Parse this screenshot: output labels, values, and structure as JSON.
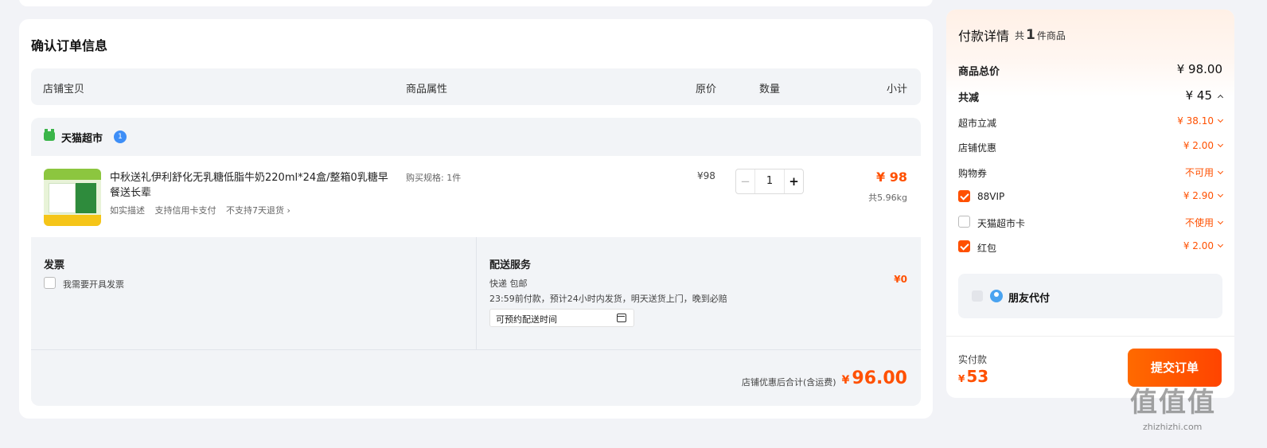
{
  "order": {
    "title": "确认订单信息",
    "headers": {
      "item": "店铺宝贝",
      "attr": "商品属性",
      "price": "原价",
      "qty": "数量",
      "subtotal": "小计"
    },
    "store": {
      "name": "天猫超市",
      "badge": "1"
    },
    "item": {
      "title": "中秋送礼伊利舒化无乳糖低脂牛奶220ml*24盒/整箱0乳糖早餐送长辈",
      "tags": [
        "如实描述",
        "支持信用卡支付",
        "不支持7天退货 ›"
      ],
      "spec": "购买规格: 1件",
      "price": "¥98",
      "qty": "1",
      "subtotal": "¥ 98",
      "weight": "共5.96kg"
    },
    "invoice": {
      "title": "发票",
      "option": "我需要开具发票"
    },
    "delivery": {
      "title": "配送服务",
      "method": "快递 包邮",
      "desc": "23:59前付款，预计24小时内发货，明天送货上门，晚到必赔",
      "input_placeholder": "可预约配送时间",
      "price": "¥0"
    },
    "total": {
      "label": "店铺优惠后合计(含运费)",
      "currency": "¥",
      "value": "96.00"
    }
  },
  "payment": {
    "title": "付款详情",
    "count_prefix": "共",
    "count": "1",
    "count_suffix": "件商品",
    "goods_total_label": "商品总价",
    "goods_total": "¥ 98.00",
    "discount_label": "共减",
    "discount": "¥ 45",
    "rows": [
      {
        "label": "超市立减",
        "value": "¥ 38.10"
      },
      {
        "label": "店铺优惠",
        "value": "¥ 2.00"
      },
      {
        "label": "购物券",
        "value": "不可用"
      },
      {
        "label": "88VIP",
        "value": "¥ 2.90",
        "checked": true
      },
      {
        "label": "天猫超市卡",
        "value": "不使用",
        "checked": false
      },
      {
        "label": "红包",
        "value": "¥ 2.00",
        "checked": true
      }
    ],
    "friend_pay": "朋友代付",
    "paid_label": "实付款",
    "paid_currency": "¥",
    "paid_value": "53",
    "submit": "提交订单"
  },
  "watermark": {
    "big": "值值值",
    "small": "zhizhizhi.com"
  },
  "colors": {
    "accent": "#ff5000",
    "panel_bg": "#f2f4f7",
    "page_bg": "#f2f3f7"
  }
}
